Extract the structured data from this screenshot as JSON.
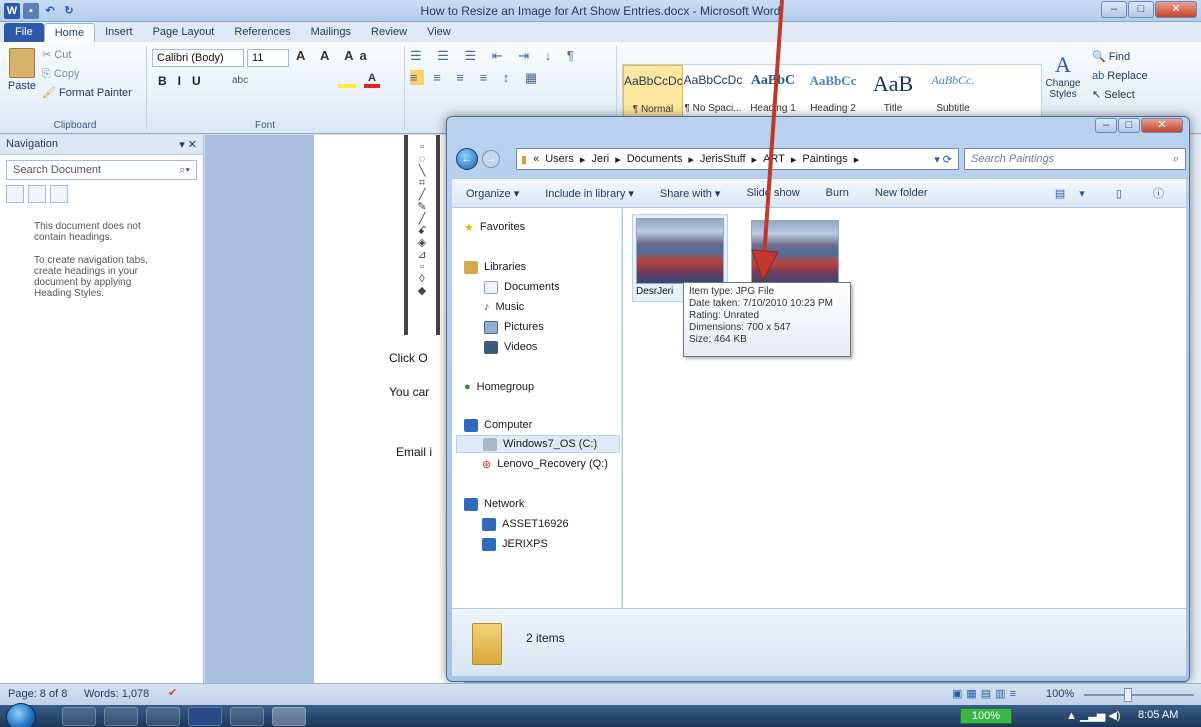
{
  "word": {
    "title": "How to Resize an Image for Art Show Entries.docx - Microsoft Word",
    "tabs": [
      "File",
      "Home",
      "Insert",
      "Page Layout",
      "References",
      "Mailings",
      "Review",
      "View"
    ],
    "clipboard": {
      "cut": "Cut",
      "copy": "Copy",
      "paste": "Paste",
      "format_painter": "Format Painter",
      "label": "Clipboard"
    },
    "font": {
      "name": "Calibri (Body)",
      "size": "11",
      "label": "Font"
    },
    "styles": [
      {
        "preview": "AaBbCcDc",
        "name": "¶ Normal"
      },
      {
        "preview": "AaBbCcDc",
        "name": "¶ No Spaci..."
      },
      {
        "preview": "AaBbC",
        "name": "Heading 1"
      },
      {
        "preview": "AaBbCc",
        "name": "Heading 2"
      },
      {
        "preview": "AaB",
        "name": "Title"
      },
      {
        "preview": "AaBbCc.",
        "name": "Subtitle"
      }
    ],
    "change_styles": "Change Styles",
    "editing": {
      "find": "Find",
      "replace": "Replace",
      "select": "Select"
    },
    "navigation": {
      "title": "Navigation",
      "search_placeholder": "Search Document",
      "message1": "This document does not contain headings.",
      "message2": "To create navigation tabs, create headings in your document by applying Heading Styles."
    },
    "doc_text": [
      "Click O",
      "You car",
      "Email i"
    ],
    "status": {
      "page": "Page: 8 of 8",
      "words": "Words: 1,078",
      "zoom": "100%"
    }
  },
  "explorer": {
    "breadcrumb": [
      "«",
      "Users",
      "Jeri",
      "Documents",
      "JerisStuff",
      "ART",
      "Paintings"
    ],
    "search_placeholder": "Search Paintings",
    "commands": [
      "Organize ▾",
      "Include in library ▾",
      "Share with ▾",
      "Slide show",
      "Burn",
      "New folder"
    ],
    "tree": {
      "favorites": "Favorites",
      "libraries": "Libraries",
      "documents": "Documents",
      "music": "Music",
      "pictures": "Pictures",
      "videos": "Videos",
      "homegroup": "Homegroup",
      "computer": "Computer",
      "drive_c": "Windows7_OS (C:)",
      "drive_q": "Lenovo_Recovery (Q:)",
      "network": "Network",
      "net1": "ASSET16926",
      "net2": "JERIXPS"
    },
    "file1_label": "DesrJeri",
    "tooltip": [
      "Item type: JPG File",
      "Date taken: 7/10/2010 10:23 PM",
      "Rating: Unrated",
      "Dimensions: 700 x 547",
      "Size: 464 KB"
    ],
    "items_count": "2 items"
  },
  "taskbar": {
    "zoom_badge": "100%",
    "time": "8:05 AM"
  },
  "colors": {
    "arrow": "#c0392b",
    "file_tab": "#2a5ba8"
  }
}
